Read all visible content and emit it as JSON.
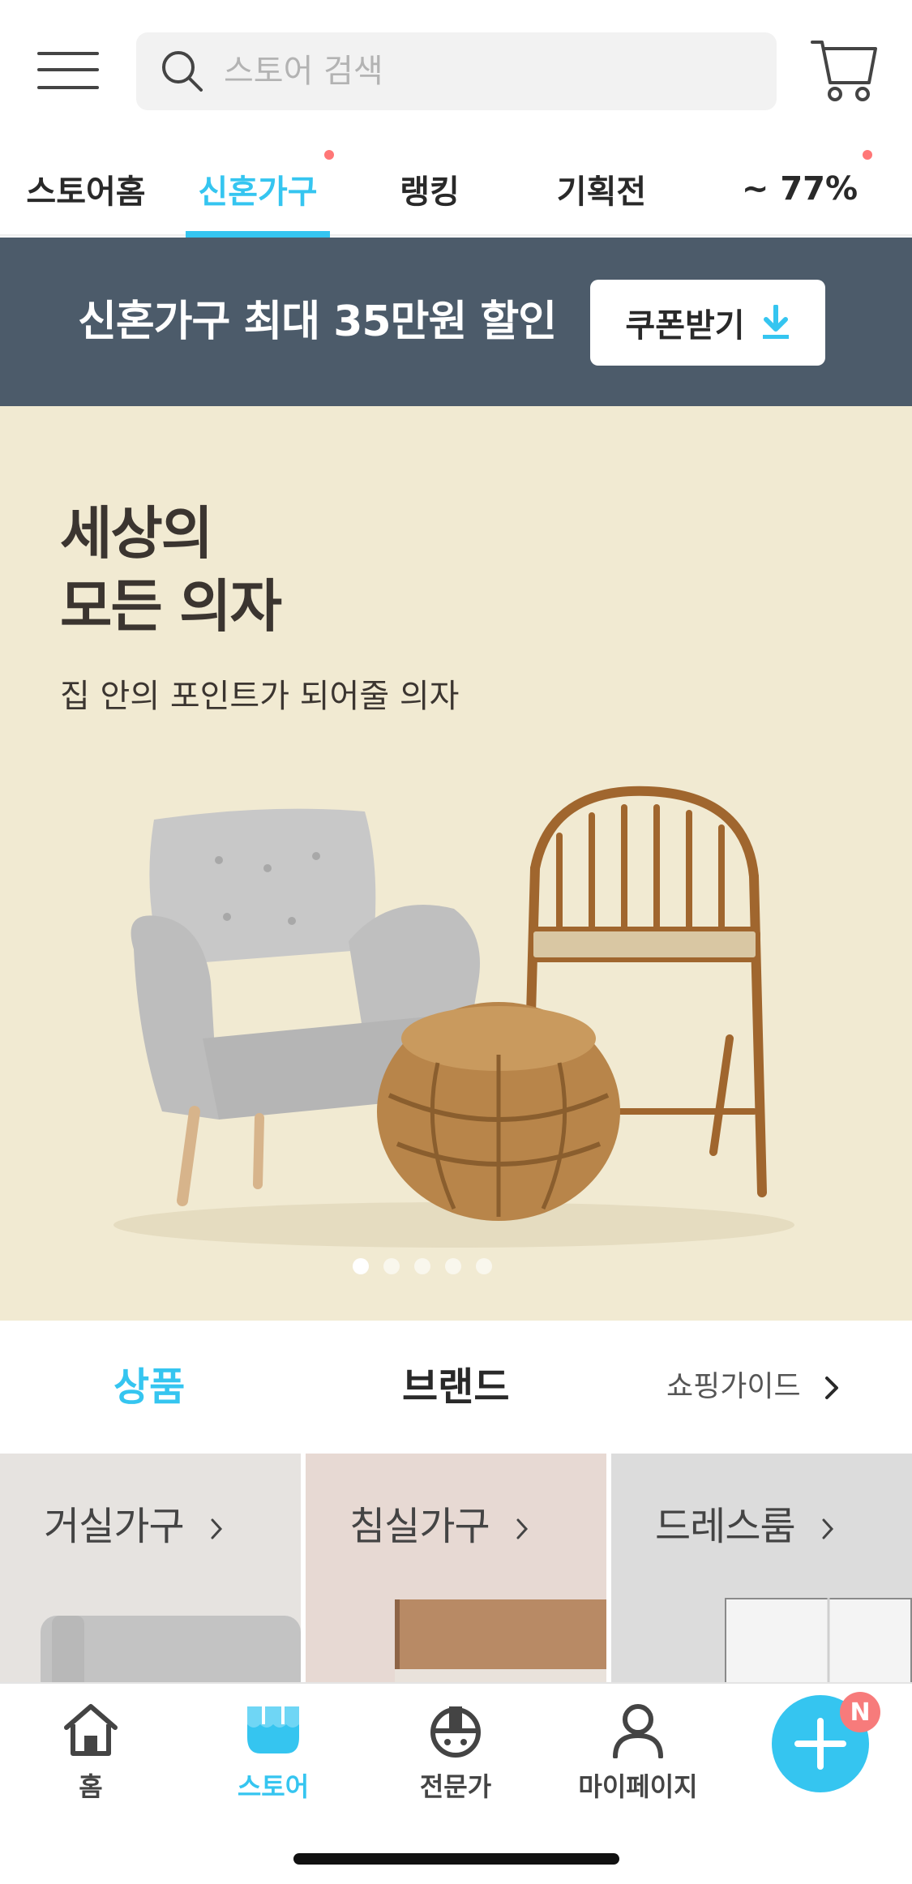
{
  "header": {
    "search_placeholder": "스토어 검색"
  },
  "tabs": [
    {
      "label": "스토어홈"
    },
    {
      "label": "신혼가구"
    },
    {
      "label": "랭킹"
    },
    {
      "label": "기획전"
    },
    {
      "label": "~ 77%"
    }
  ],
  "coupon": {
    "text": "신혼가구 최대 35만원 할인",
    "button_label": "쿠폰받기"
  },
  "hero": {
    "title": "세상의\n모든 의자",
    "subtitle": "집 안의 포인트가 되어줄 의자",
    "page_count": 5,
    "current_page": 1
  },
  "section_tabs": {
    "products": "상품",
    "brand": "브랜드",
    "guide": "쇼핑가이드"
  },
  "categories": [
    {
      "label": "거실가구"
    },
    {
      "label": "침실가구"
    },
    {
      "label": "드레스룸"
    }
  ],
  "bottom_nav": {
    "home": "홈",
    "store": "스토어",
    "expert": "전문가",
    "mypage": "마이페이지",
    "badge": "N"
  },
  "colors": {
    "accent": "#35c5f0",
    "banner": "#4c5b6a",
    "hero_bg": "#f1ead2",
    "badge": "#f77b7b"
  }
}
